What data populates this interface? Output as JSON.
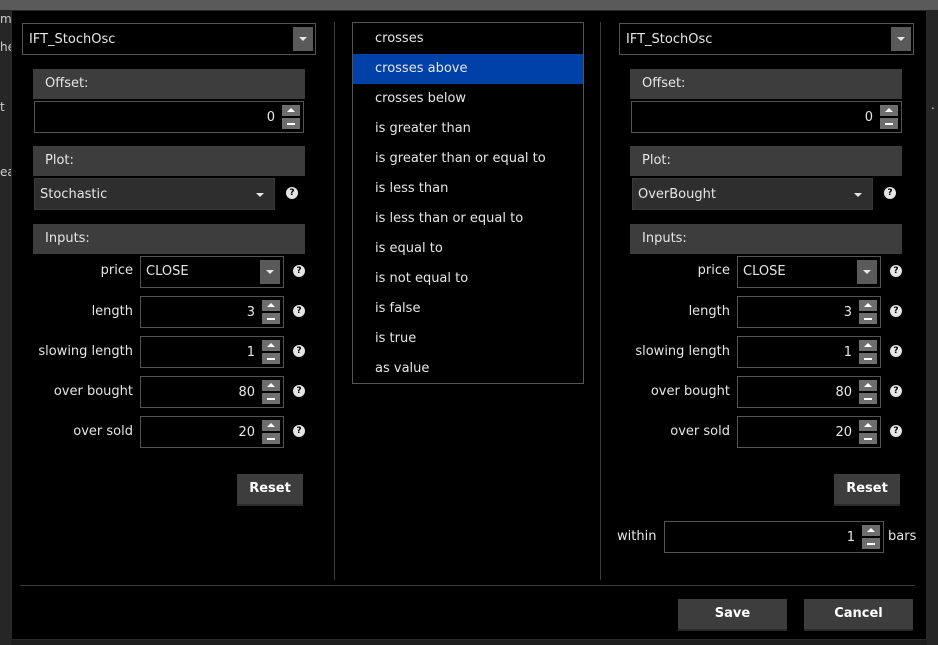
{
  "background": {
    "fragments": [
      "mi",
      "he",
      "t",
      "ea"
    ],
    "dot_right": "."
  },
  "left": {
    "study": "IFT_StochOsc",
    "offset_label": "Offset:",
    "offset_value": "0",
    "plot_label": "Plot:",
    "plot_value": "Stochastic",
    "inputs_label": "Inputs:",
    "price_label": "price",
    "price_value": "CLOSE",
    "length_label": "length",
    "length_value": "3",
    "slowing_label": "slowing length",
    "slowing_value": "1",
    "overbought_label": "over bought",
    "overbought_value": "80",
    "oversold_label": "over sold",
    "oversold_value": "20",
    "reset_label": "Reset"
  },
  "conditions": {
    "items": [
      "crosses",
      "crosses above",
      "crosses below",
      "is greater than",
      "is greater than or equal to",
      "is less than",
      "is less than or equal to",
      "is equal to",
      "is not equal to",
      "is false",
      "is true",
      "as value"
    ],
    "selected": "crosses above"
  },
  "right": {
    "study": "IFT_StochOsc",
    "offset_label": "Offset:",
    "offset_value": "0",
    "plot_label": "Plot:",
    "plot_value": "OverBought",
    "inputs_label": "Inputs:",
    "price_label": "price",
    "price_value": "CLOSE",
    "length_label": "length",
    "length_value": "3",
    "slowing_label": "slowing length",
    "slowing_value": "1",
    "overbought_label": "over bought",
    "overbought_value": "80",
    "oversold_label": "over sold",
    "oversold_value": "20",
    "reset_label": "Reset",
    "within_label": "within",
    "within_value": "1",
    "bars_label": "bars"
  },
  "footer": {
    "save_label": "Save",
    "cancel_label": "Cancel"
  },
  "colors": {
    "selection": "#0041a8",
    "section_header": "#3d3d3d",
    "background": "#000000"
  }
}
